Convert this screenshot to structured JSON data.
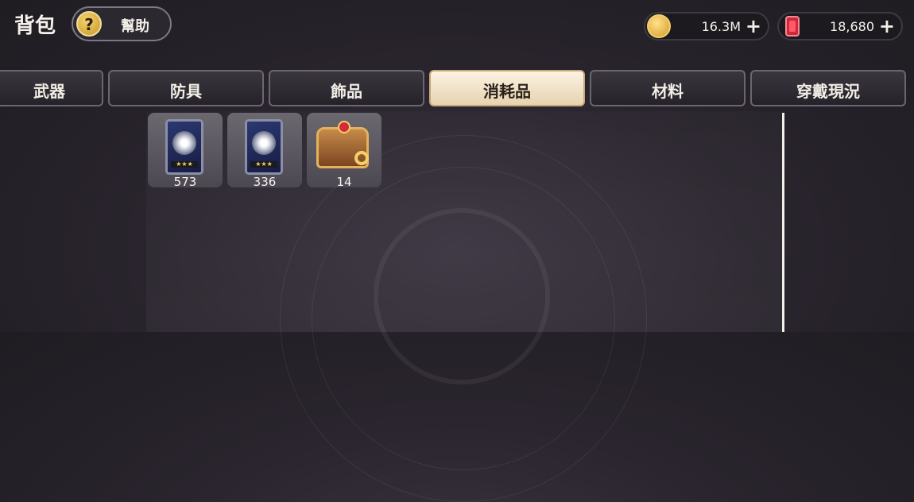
{
  "header": {
    "title": "背包",
    "help_label": "幫助",
    "help_icon_glyph": "?"
  },
  "currencies": [
    {
      "name": "gold",
      "icon": "gold-coin-icon",
      "value": "16.3M",
      "plus": "+"
    },
    {
      "name": "gem",
      "icon": "red-gem-icon",
      "value": "18,680",
      "plus": "+"
    }
  ],
  "tabs": [
    {
      "label": "武器",
      "active": false
    },
    {
      "label": "防具",
      "active": false
    },
    {
      "label": "飾品",
      "active": false
    },
    {
      "label": "消耗品",
      "active": true
    },
    {
      "label": "材料",
      "active": false
    },
    {
      "label": "穿戴現況",
      "active": false
    }
  ],
  "items": [
    {
      "icon": "card-icon",
      "count": "573"
    },
    {
      "icon": "card-icon",
      "count": "336"
    },
    {
      "icon": "treasure-chest-icon",
      "count": "14"
    }
  ],
  "colors": {
    "active_tab": "#f5e9d2",
    "gold": "#e0a73a",
    "gem": "#d0283a"
  }
}
